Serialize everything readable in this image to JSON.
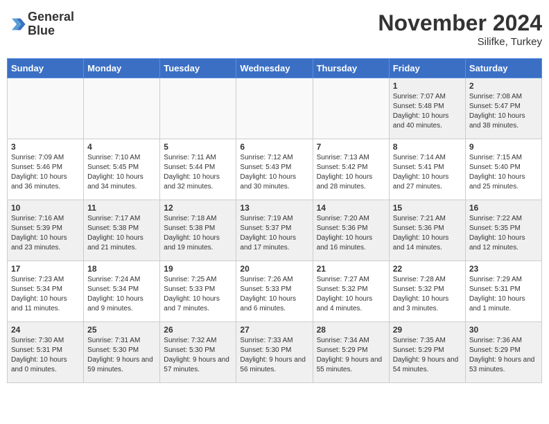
{
  "header": {
    "logo_line1": "General",
    "logo_line2": "Blue",
    "month": "November 2024",
    "location": "Silifke, Turkey"
  },
  "weekdays": [
    "Sunday",
    "Monday",
    "Tuesday",
    "Wednesday",
    "Thursday",
    "Friday",
    "Saturday"
  ],
  "weeks": [
    [
      {
        "day": "",
        "info": ""
      },
      {
        "day": "",
        "info": ""
      },
      {
        "day": "",
        "info": ""
      },
      {
        "day": "",
        "info": ""
      },
      {
        "day": "",
        "info": ""
      },
      {
        "day": "1",
        "info": "Sunrise: 7:07 AM\nSunset: 5:48 PM\nDaylight: 10 hours and 40 minutes."
      },
      {
        "day": "2",
        "info": "Sunrise: 7:08 AM\nSunset: 5:47 PM\nDaylight: 10 hours and 38 minutes."
      }
    ],
    [
      {
        "day": "3",
        "info": "Sunrise: 7:09 AM\nSunset: 5:46 PM\nDaylight: 10 hours and 36 minutes."
      },
      {
        "day": "4",
        "info": "Sunrise: 7:10 AM\nSunset: 5:45 PM\nDaylight: 10 hours and 34 minutes."
      },
      {
        "day": "5",
        "info": "Sunrise: 7:11 AM\nSunset: 5:44 PM\nDaylight: 10 hours and 32 minutes."
      },
      {
        "day": "6",
        "info": "Sunrise: 7:12 AM\nSunset: 5:43 PM\nDaylight: 10 hours and 30 minutes."
      },
      {
        "day": "7",
        "info": "Sunrise: 7:13 AM\nSunset: 5:42 PM\nDaylight: 10 hours and 28 minutes."
      },
      {
        "day": "8",
        "info": "Sunrise: 7:14 AM\nSunset: 5:41 PM\nDaylight: 10 hours and 27 minutes."
      },
      {
        "day": "9",
        "info": "Sunrise: 7:15 AM\nSunset: 5:40 PM\nDaylight: 10 hours and 25 minutes."
      }
    ],
    [
      {
        "day": "10",
        "info": "Sunrise: 7:16 AM\nSunset: 5:39 PM\nDaylight: 10 hours and 23 minutes."
      },
      {
        "day": "11",
        "info": "Sunrise: 7:17 AM\nSunset: 5:38 PM\nDaylight: 10 hours and 21 minutes."
      },
      {
        "day": "12",
        "info": "Sunrise: 7:18 AM\nSunset: 5:38 PM\nDaylight: 10 hours and 19 minutes."
      },
      {
        "day": "13",
        "info": "Sunrise: 7:19 AM\nSunset: 5:37 PM\nDaylight: 10 hours and 17 minutes."
      },
      {
        "day": "14",
        "info": "Sunrise: 7:20 AM\nSunset: 5:36 PM\nDaylight: 10 hours and 16 minutes."
      },
      {
        "day": "15",
        "info": "Sunrise: 7:21 AM\nSunset: 5:36 PM\nDaylight: 10 hours and 14 minutes."
      },
      {
        "day": "16",
        "info": "Sunrise: 7:22 AM\nSunset: 5:35 PM\nDaylight: 10 hours and 12 minutes."
      }
    ],
    [
      {
        "day": "17",
        "info": "Sunrise: 7:23 AM\nSunset: 5:34 PM\nDaylight: 10 hours and 11 minutes."
      },
      {
        "day": "18",
        "info": "Sunrise: 7:24 AM\nSunset: 5:34 PM\nDaylight: 10 hours and 9 minutes."
      },
      {
        "day": "19",
        "info": "Sunrise: 7:25 AM\nSunset: 5:33 PM\nDaylight: 10 hours and 7 minutes."
      },
      {
        "day": "20",
        "info": "Sunrise: 7:26 AM\nSunset: 5:33 PM\nDaylight: 10 hours and 6 minutes."
      },
      {
        "day": "21",
        "info": "Sunrise: 7:27 AM\nSunset: 5:32 PM\nDaylight: 10 hours and 4 minutes."
      },
      {
        "day": "22",
        "info": "Sunrise: 7:28 AM\nSunset: 5:32 PM\nDaylight: 10 hours and 3 minutes."
      },
      {
        "day": "23",
        "info": "Sunrise: 7:29 AM\nSunset: 5:31 PM\nDaylight: 10 hours and 1 minute."
      }
    ],
    [
      {
        "day": "24",
        "info": "Sunrise: 7:30 AM\nSunset: 5:31 PM\nDaylight: 10 hours and 0 minutes."
      },
      {
        "day": "25",
        "info": "Sunrise: 7:31 AM\nSunset: 5:30 PM\nDaylight: 9 hours and 59 minutes."
      },
      {
        "day": "26",
        "info": "Sunrise: 7:32 AM\nSunset: 5:30 PM\nDaylight: 9 hours and 57 minutes."
      },
      {
        "day": "27",
        "info": "Sunrise: 7:33 AM\nSunset: 5:30 PM\nDaylight: 9 hours and 56 minutes."
      },
      {
        "day": "28",
        "info": "Sunrise: 7:34 AM\nSunset: 5:29 PM\nDaylight: 9 hours and 55 minutes."
      },
      {
        "day": "29",
        "info": "Sunrise: 7:35 AM\nSunset: 5:29 PM\nDaylight: 9 hours and 54 minutes."
      },
      {
        "day": "30",
        "info": "Sunrise: 7:36 AM\nSunset: 5:29 PM\nDaylight: 9 hours and 53 minutes."
      }
    ]
  ]
}
